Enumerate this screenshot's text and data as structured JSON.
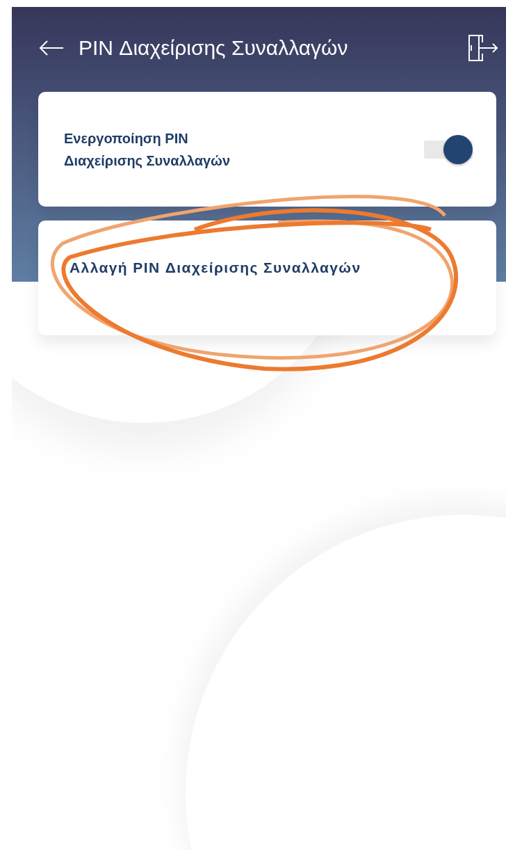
{
  "header": {
    "title": "PIN Διαχείρισης Συναλλαγών"
  },
  "settings": [
    {
      "kind": "toggle",
      "label": "Ενεργοποίηση PIN Διαχείρισης Συναλλαγών",
      "on": true
    },
    {
      "kind": "link",
      "label": "Αλλαγή PIN Διαχείρισης Συναλλαγών"
    }
  ]
}
